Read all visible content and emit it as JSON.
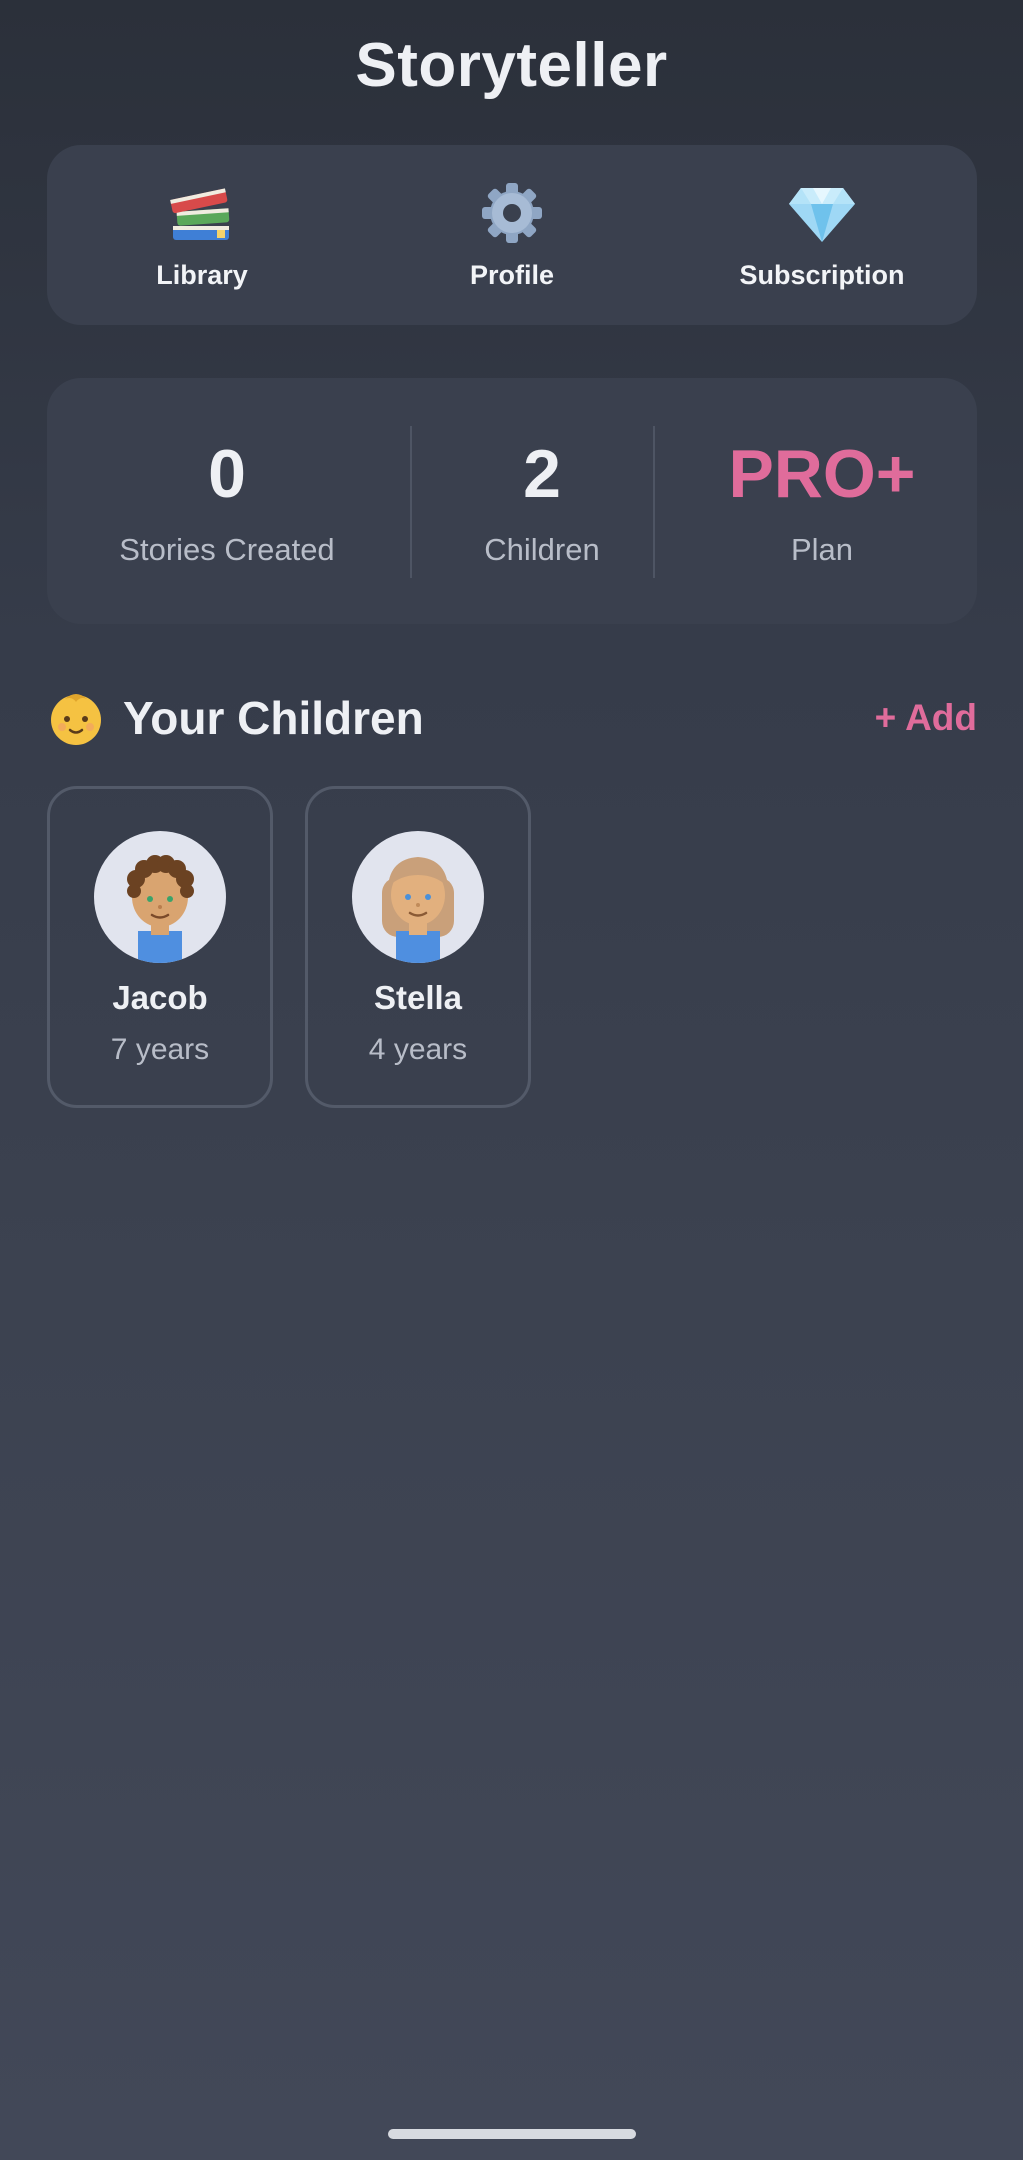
{
  "app": {
    "title": "Storyteller"
  },
  "nav": {
    "items": [
      {
        "label": "Library",
        "icon": "books-icon"
      },
      {
        "label": "Profile",
        "icon": "gear-icon"
      },
      {
        "label": "Subscription",
        "icon": "diamond-icon"
      }
    ]
  },
  "stats": {
    "stories_created": {
      "value": "0",
      "label": "Stories Created"
    },
    "children": {
      "value": "2",
      "label": "Children"
    },
    "plan": {
      "value": "PRO+",
      "label": "Plan"
    }
  },
  "children_section": {
    "icon": "baby-face-icon",
    "title": "Your Children",
    "add_label": "+ Add"
  },
  "children": [
    {
      "name": "Jacob",
      "age": "7 years",
      "avatar": "boy-avatar-icon"
    },
    {
      "name": "Stella",
      "age": "4 years",
      "avatar": "girl-avatar-icon"
    }
  ],
  "colors": {
    "accent": "#e06c9b",
    "card": "#3a404e",
    "background_top": "#2b303a",
    "background_bottom": "#424858"
  }
}
